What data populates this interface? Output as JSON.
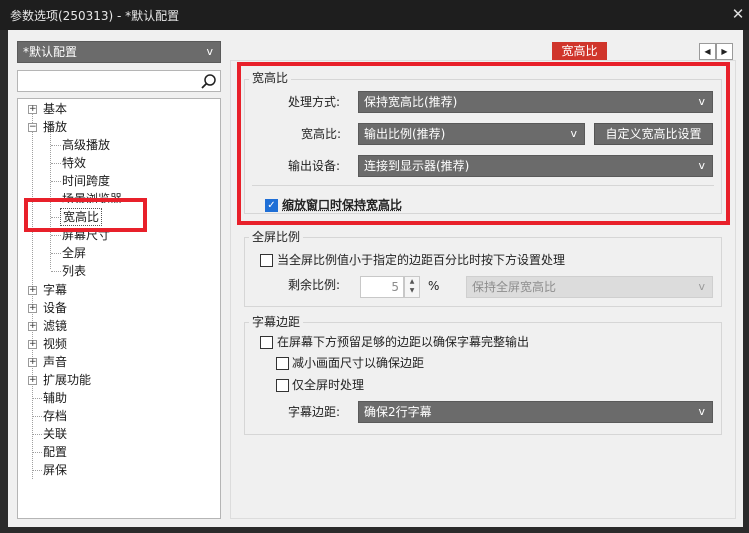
{
  "window": {
    "title": "参数选项(250313) - *默认配置"
  },
  "profile": {
    "value": "*默认配置"
  },
  "search": {
    "placeholder": ""
  },
  "tree": {
    "basic": "基本",
    "playback": "播放",
    "playback_children": [
      "高级播放",
      "特效",
      "时间跨度",
      "场景浏览器",
      "宽高比",
      "屏幕尺寸",
      "全屏",
      "列表"
    ],
    "top_items": [
      "字幕",
      "设备",
      "滤镜",
      "视频",
      "声音",
      "扩展功能"
    ],
    "leaf_items": [
      "辅助",
      "存档",
      "关联",
      "配置",
      "屏保"
    ]
  },
  "tab": {
    "label": "宽高比"
  },
  "aspect": {
    "group_title": "宽高比",
    "method_label": "处理方式:",
    "method_value": "保持宽高比(推荐)",
    "ratio_label": "宽高比:",
    "ratio_value": "输出比例(推荐)",
    "custom_button": "自定义宽高比设置",
    "output_label": "输出设备:",
    "output_value": "连接到显示器(推荐)",
    "keep_on_scale": {
      "label": "缩放窗口时保持宽高比",
      "checked": true
    }
  },
  "fullscreen": {
    "group_title": "全屏比例",
    "check_label": "当全屏比例值小于指定的边距百分比时按下方设置处理",
    "remain_label": "剩余比例:",
    "remain_value": "5",
    "unit": "%",
    "mode_value": "保持全屏宽高比"
  },
  "subtitle_margin": {
    "group_title": "字幕边距",
    "reserve_label": "在屏幕下方预留足够的边距以确保字幕完整输出",
    "shrink_label": "减小画面尺寸以确保边距",
    "fullscreen_only_label": "仅全屏时处理",
    "margin_label": "字幕边距:",
    "margin_value": "确保2行字幕"
  },
  "colors": {
    "highlight": "#e8202a",
    "tab": "#d0352b",
    "dropdown": "#6b6b6b",
    "check": "#1f6fd6"
  }
}
